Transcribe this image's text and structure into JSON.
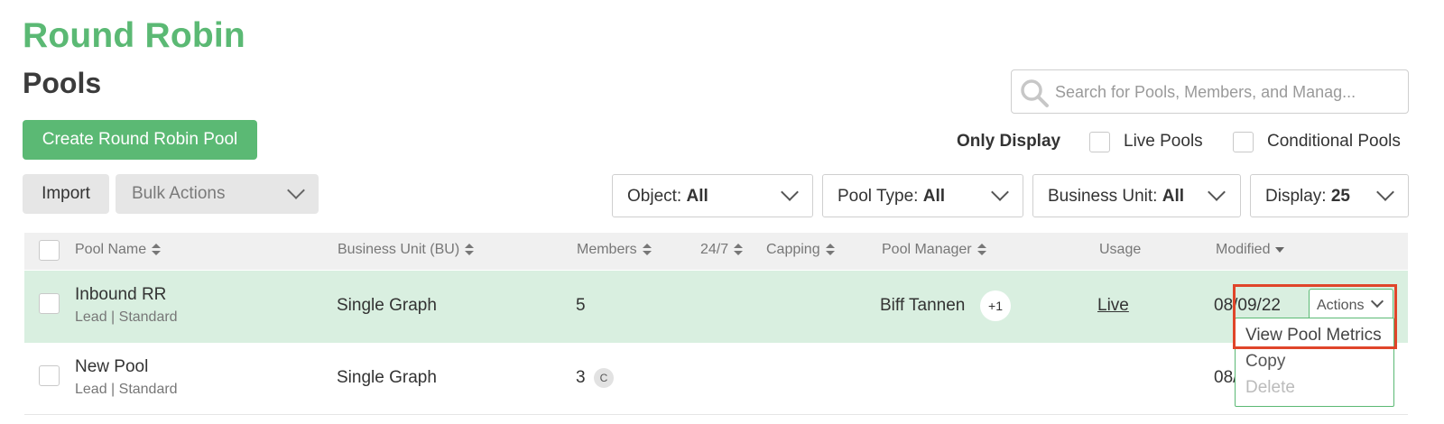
{
  "header": {
    "app_title": "Round Robin",
    "page_title": "Pools"
  },
  "search": {
    "placeholder": "Search for Pools, Members, and Manag..."
  },
  "toolbar": {
    "create_label": "Create Round Robin Pool",
    "import_label": "Import",
    "bulk_actions_label": "Bulk Actions"
  },
  "display_options": {
    "label": "Only Display",
    "live_pools_label": "Live Pools",
    "conditional_pools_label": "Conditional Pools"
  },
  "filters": {
    "object": {
      "label": "Object: ",
      "value": "All"
    },
    "pool_type": {
      "label": "Pool Type: ",
      "value": "All"
    },
    "business_unit": {
      "label": "Business Unit: ",
      "value": "All"
    },
    "display": {
      "label": "Display: ",
      "value": "25"
    }
  },
  "table": {
    "columns": [
      "Pool Name",
      "Business Unit (BU)",
      "Members",
      "24/7",
      "Capping",
      "Pool Manager",
      "Usage",
      "Modified"
    ],
    "rows": [
      {
        "name": "Inbound RR",
        "subtitle": "Lead | Standard",
        "business_unit": "Single Graph",
        "members": "5",
        "manager": "Biff Tannen",
        "manager_extra": "+1",
        "usage": "Live",
        "modified": "08/09/22",
        "actions_label": "Actions"
      },
      {
        "name": "New Pool",
        "subtitle": "Lead | Standard",
        "business_unit": "Single Graph",
        "members": "3",
        "member_badge": "C",
        "manager": "",
        "usage": "",
        "modified": "08/"
      }
    ]
  },
  "actions_menu": {
    "items": [
      "View Pool Metrics",
      "Copy",
      "Delete"
    ]
  },
  "colors": {
    "brand_green": "#5bb974",
    "selected_row": "#d9efe0",
    "highlight_red": "#e0452a"
  }
}
